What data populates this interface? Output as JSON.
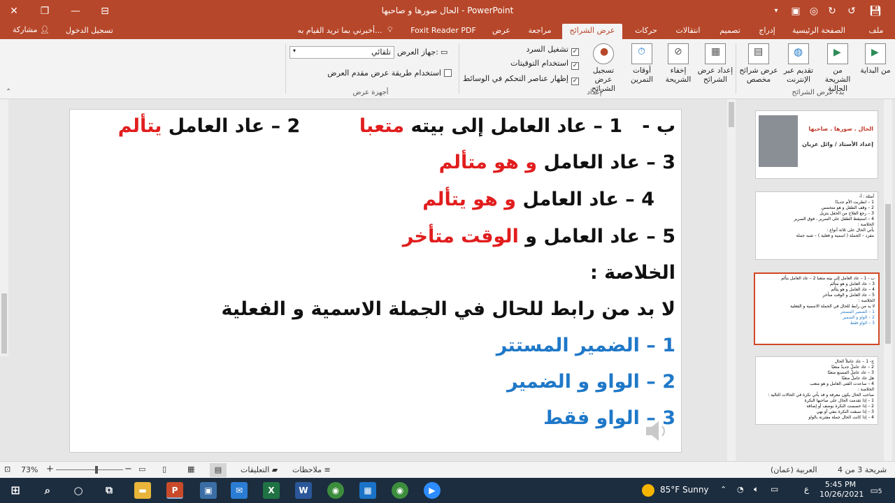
{
  "window": {
    "title": "الحال صورها و صاحبها - PowerPoint"
  },
  "account": {
    "sign_in": "تسجيل الدخول",
    "share": "مشاركة"
  },
  "tabs": [
    {
      "label": "ملف"
    },
    {
      "label": "الصفحة الرئيسية"
    },
    {
      "label": "إدراج"
    },
    {
      "label": "تصميم"
    },
    {
      "label": "انتقالات"
    },
    {
      "label": "حركات"
    },
    {
      "label": "عرض الشرائح"
    },
    {
      "label": "مراجعة"
    },
    {
      "label": "عرض"
    },
    {
      "label": "Foxit Reader PDF"
    },
    {
      "label": "أخبرني بما تريد القيام به..."
    }
  ],
  "ribbon": {
    "start_group": {
      "label": "بدء عرض الشرائح",
      "from_beginning": "من البداية",
      "from_current": "من الشريحة الحالية",
      "online": "تقديم عبر الإنترنت",
      "custom": "عرض شرائح مخصص"
    },
    "setup_group": {
      "label": "إعداد",
      "setup_show": "إعداد عرض الشرائح",
      "hide_slide": "إخفاء الشريحة",
      "rehearse": "أوقات التمرين",
      "record": "تسجيل عرض الشرائح",
      "play_narrations": "تشغيل السرد",
      "use_timings": "استخدام التوقيتات",
      "show_media_controls": "إظهار عناصر التحكم في الوسائط"
    },
    "monitors_group": {
      "label": "أجهزة عرض",
      "monitor_label": "جهاز العرض:",
      "monitor_value": "تلقائي",
      "presenter_view": "استخدام طريقة عرض مقدم العرض"
    }
  },
  "slide": {
    "line1_prefix": "ب -",
    "line1_num": "1",
    "line1_text": "– عاد العامل إلى بيته",
    "line1_red": "متعبا",
    "line1b_num": "2",
    "line1b_text": "– عاد العامل",
    "line1b_red": "يتألم",
    "line2_num": "3",
    "line2_text": "– عاد العامل",
    "line2_red": "و هو متألم",
    "line3_num": "4",
    "line3_text": "– عاد العامل",
    "line3_red": "و هو يتألم",
    "line4_num": "5",
    "line4_text": "– عاد العامل و",
    "line4_red": "الوقت متأخر",
    "conclusion": "الخلاصة :",
    "rule": "لا بد من رابط للحال في الجملة الاسمية و الفعلية",
    "item1": "1 – الضمير المستتر",
    "item2": "2 – الواو و الضمير",
    "item3": "3 – الواو فقط"
  },
  "thumbnails": [
    {
      "num": "1",
      "title": "الحال . صورها . صاحبها",
      "author": "إعداد الأستاذ / وائل عريان"
    },
    {
      "num": "2",
      "lines": [
        "أمثلة : أ-",
        "1 – انطربت الأم جديدًا",
        "2 – وقف الطفل و هو متحمس",
        "3 – رجع الفلاح من الحقل يتزيل",
        "4 – استيقظ الطفل على السرير ، فوق السرير",
        "الخلاصة :",
        "يأتي الحال على ثلاثة أنواع :",
        "مفرد – الجملة ( اسمية و فعلية ) – شبه جملة"
      ]
    },
    {
      "num": "3",
      "lines": [
        "ب - 1 – عاد العامل إلى بيته متعبا    2 – عاد العامل يتألم",
        "3 – عاد العامل و هو متألم",
        "4 – عاد العامل و هو يتألم",
        "5 – عاد العامل و الوقت متأخر",
        "الخلاصة :",
        "لا بد من رابط للحال في الجملة الاسمية و الفعلية",
        "1 – الضمير المستتر",
        "2 – الواو و الضمير",
        "3 – الواو فقط"
      ]
    },
    {
      "num": "4",
      "lines": [
        "ج- 1 – عاد عاملاً الحال",
        "2 – عاد عاملٌ جديدٌ متعبًا",
        "3 – عاد عاملُ المصنع متعبًا",
        "هل عاد عاملٌ متعبًا",
        "4 – ساعدت الفتى العامل و هو متعب",
        "الخلاصة :",
        "صاحب الحال يكون معرفة و قد يأتي نكرة في الحالات التالية :",
        "1 – إذا تقدمت الحال على صاحبها النكرة",
        "2 – إذا خصصت النكرة بوصف أو إضافة",
        "3 – إذا سبقت النكرة بنفي أو نهي",
        "4 – إذا كانت الحال جملة مقترنة بالواو"
      ]
    }
  ],
  "statusbar": {
    "slide_info": "شريحة 3 من 4",
    "language": "العربية (عمان)",
    "notes": "ملاحظات",
    "comments": "التعليقات",
    "zoom": "73%"
  },
  "taskbar": {
    "weather_temp": "85°F",
    "weather_text": "Sunny",
    "time": "5:45 PM",
    "date": "10/26/2021",
    "lang": "ع",
    "notifications": "5"
  },
  "colors": {
    "accent": "#b7472a",
    "red_text": "#e11d1d",
    "blue_text": "#1f78c8"
  }
}
